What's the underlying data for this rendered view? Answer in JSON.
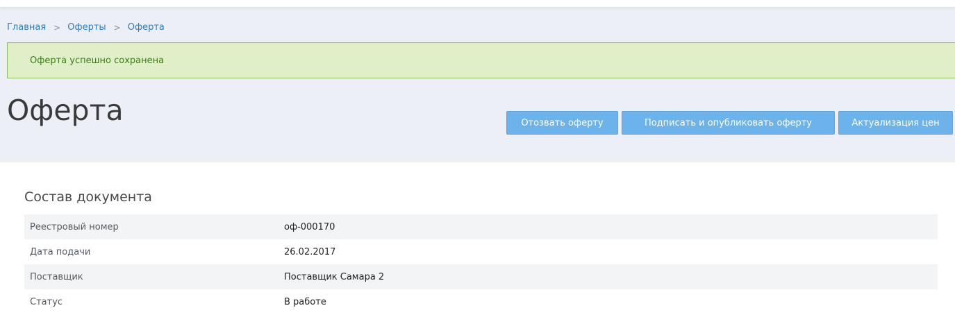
{
  "breadcrumb": {
    "items": [
      "Главная",
      "Оферты",
      "Оферта"
    ],
    "separator": ">"
  },
  "alert": {
    "message": "Оферта успешно сохранена"
  },
  "page": {
    "title": "Оферта"
  },
  "actions": {
    "revoke_label": "Отозвать оферту",
    "sign_publish_label": "Подписать и опубликовать оферту",
    "price_update_label": "Актуализация цен"
  },
  "document": {
    "section_title": "Состав документа",
    "rows": [
      {
        "label": "Реестровый номер",
        "value": "оф-000170"
      },
      {
        "label": "Дата подачи",
        "value": "26.02.2017"
      },
      {
        "label": "Поставщик",
        "value": "Поставщик Самара 2"
      },
      {
        "label": "Статус",
        "value": "В работе"
      }
    ]
  },
  "colors": {
    "header_bg": "#eceff5",
    "link": "#2f7cc4",
    "alert_bg": "#dff0c8",
    "alert_border": "#8cbf5c",
    "alert_text": "#3c7a16",
    "button_bg": "#6cb3ec"
  }
}
